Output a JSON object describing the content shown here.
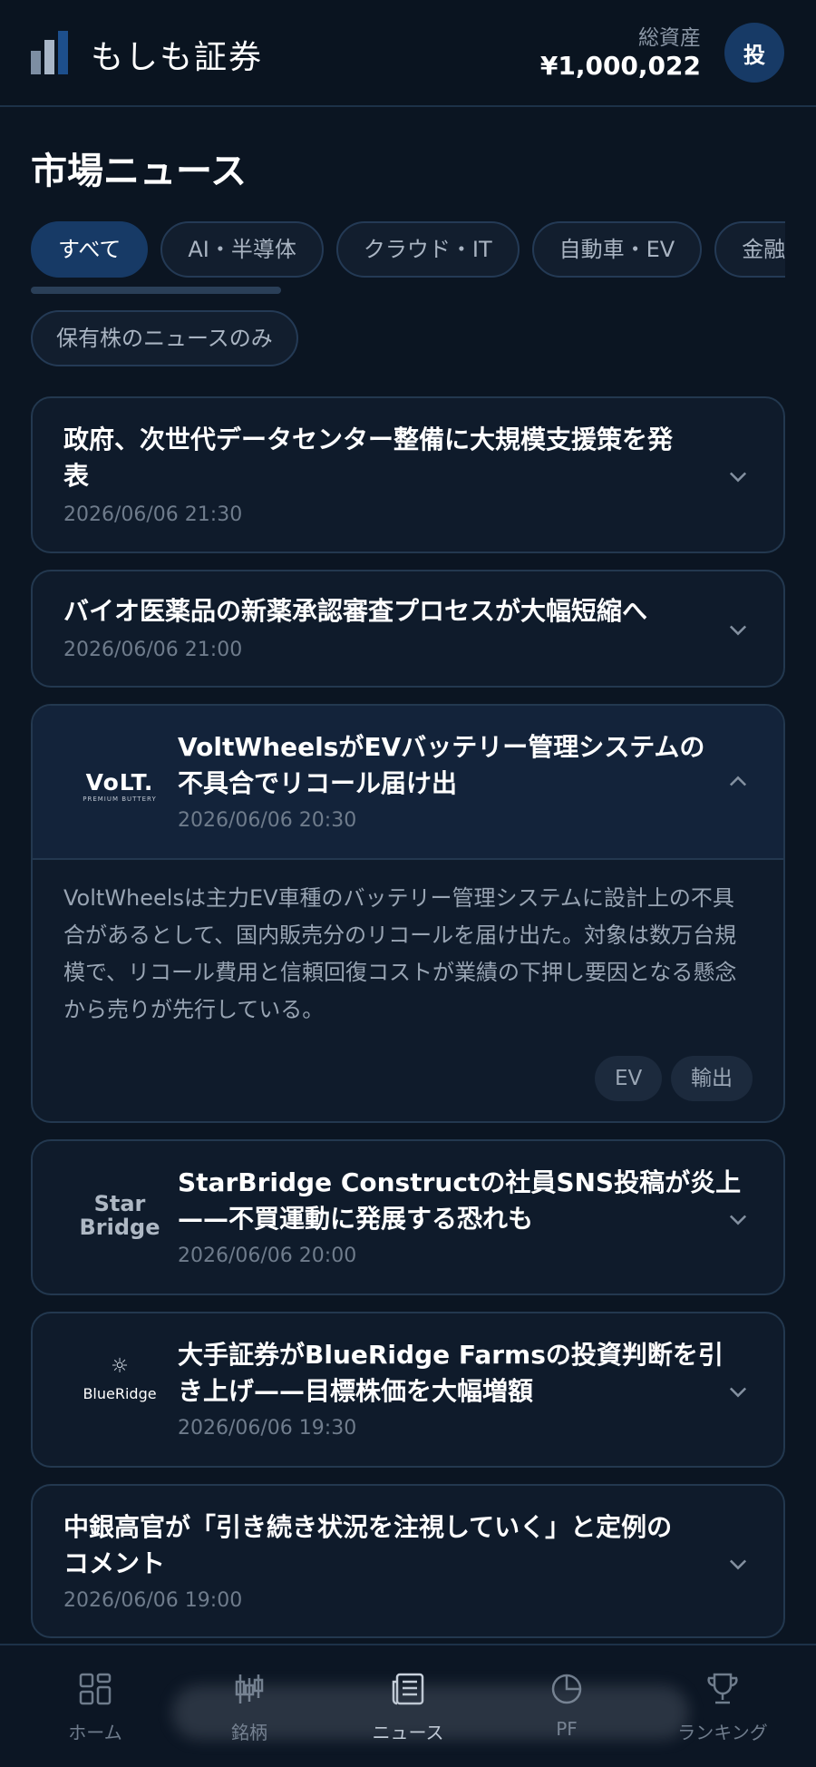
{
  "header": {
    "brand": "もしも証券",
    "total_assets_label": "総資産",
    "total_assets_value": "¥1,000,022",
    "avatar_label": "投"
  },
  "page_title": "市場ニュース",
  "categories": [
    "すべて",
    "AI・半導体",
    "クラウド・IT",
    "自動車・EV",
    "金融"
  ],
  "active_category": "すべて",
  "filter_label": "保有株のニュースのみ",
  "news": [
    {
      "title_line1": "政府、次世代データセンター整備に大規模支援策を発",
      "title_line2": "表",
      "time": "2026/06/06 21:30"
    },
    {
      "title_line1": "バイオ医薬品の新薬承認審査プロセスが大幅短縮へ",
      "time": "2026/06/06 21:00"
    },
    {
      "logo_main": "VoLT.",
      "logo_sub": "PREMIUM BUTTERY",
      "title_line1": "VoltWheelsがEVバッテリー管理システムの",
      "title_line2": "不具合でリコール届け出",
      "time": "2026/06/06 20:30",
      "body": "VoltWheelsは主力EV車種のバッテリー管理システムに設計上の不具合があるとして、国内販売分のリコールを届け出た。対象は数万台規模で、リコール費用と信頼回復コストが業績の下押し要因となる懸念から売りが先行している。",
      "tags": [
        "EV",
        "輸出"
      ]
    },
    {
      "logo_line1": "Star",
      "logo_line2": "Bridge",
      "title_line1": "StarBridge Constructの社員SNS投稿が炎上",
      "title_line2": "——不買運動に発展する恐れも",
      "time": "2026/06/06 20:00"
    },
    {
      "logo_main": "BlueRidge",
      "title_line1": "大手証券がBlueRidge Farmsの投資判断を引",
      "title_line2": "き上げ——目標株価を大幅増額",
      "time": "2026/06/06 19:30"
    },
    {
      "title_line1": "中銀高官が「引き続き状況を注視していく」と定例の",
      "title_line2": "コメント",
      "time": "2026/06/06 19:00"
    }
  ],
  "nav": [
    {
      "label": "ホーム",
      "icon": "home-grid-icon"
    },
    {
      "label": "銘柄",
      "icon": "candlestick-icon"
    },
    {
      "label": "ニュース",
      "icon": "newspaper-icon",
      "active": true
    },
    {
      "label": "PF",
      "icon": "pie-chart-icon"
    },
    {
      "label": "ランキング",
      "icon": "trophy-icon"
    }
  ],
  "colors": {
    "accent": "#173a66",
    "background": "#0b1522",
    "card": "#0f1b2b",
    "border": "#23384f"
  }
}
